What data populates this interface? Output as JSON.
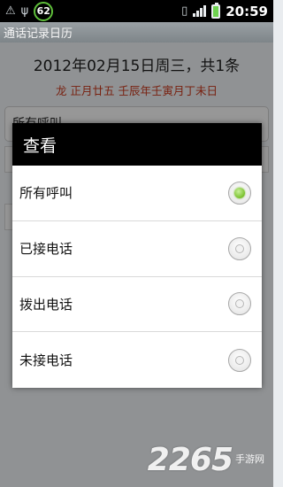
{
  "status_bar": {
    "battery_level": "62",
    "time": "20:59",
    "icons": [
      "usb-icon",
      "vibrate-icon",
      "signal-icon",
      "battery-charging-icon"
    ]
  },
  "app": {
    "title": "通话记录日历"
  },
  "header": {
    "date_summary": "2012年02月15日周三，共1条",
    "lunar": "龙 正月廿五 壬辰年壬寅月丁未日",
    "lunar_color": "#c2361b"
  },
  "filter": {
    "selected": "所有呼叫"
  },
  "dialog": {
    "title": "查看",
    "options": [
      {
        "label": "所有呼叫",
        "checked": true
      },
      {
        "label": "已接电话",
        "checked": false
      },
      {
        "label": "拨出电话",
        "checked": false
      },
      {
        "label": "未接电话",
        "checked": false
      }
    ],
    "accent_color": "#79c12c"
  },
  "watermark": {
    "number": "2265",
    "text": "手游网"
  }
}
